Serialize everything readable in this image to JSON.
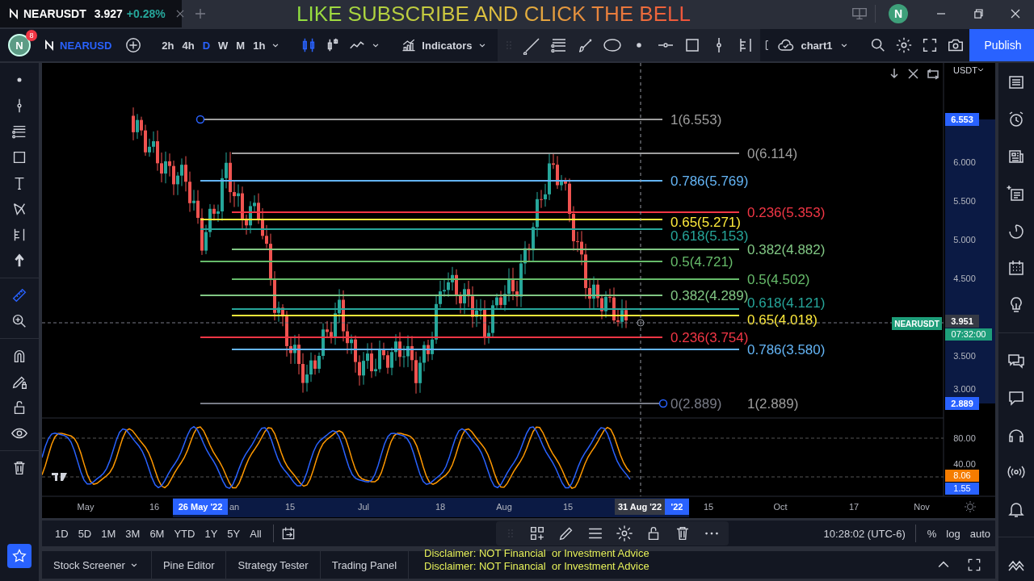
{
  "tab": {
    "symbol": "NEARUSDT",
    "price": "3.927",
    "change": "+0.28%",
    "selected": true
  },
  "banner": "LIKE SUBSCRIBE AND CLICK THE BELL",
  "account_initial": "N",
  "toolbar": {
    "avatar": "N",
    "notifications": "8",
    "symbol": "NEARUSD",
    "intervals": [
      {
        "label": "2h",
        "selected": false
      },
      {
        "label": "4h",
        "selected": false
      },
      {
        "label": "D",
        "selected": true
      },
      {
        "label": "W",
        "selected": false
      },
      {
        "label": "M",
        "selected": false
      },
      {
        "label": "1h",
        "selected": false
      }
    ],
    "chart_styles": [
      {
        "selected": true
      },
      {
        "selected": false
      },
      {
        "selected": false
      }
    ],
    "indicators": "Indicators",
    "layout": "chart1",
    "publish": "Publish"
  },
  "left_tools": [
    {
      "selected": false
    },
    {
      "selected": false
    },
    {
      "selected": false
    },
    {
      "selected": false
    },
    {
      "selected": false
    },
    {
      "selected": false
    },
    {
      "selected": false
    },
    {
      "selected": false
    },
    {
      "selected": true
    },
    {
      "selected": false
    },
    {
      "selected": false
    },
    {
      "selected": false
    },
    {
      "selected": false
    },
    {
      "selected": false
    },
    {
      "selected": false
    }
  ],
  "chart": {
    "currency": "USDT",
    "price_ticks": [
      "6.000",
      "5.500",
      "5.000",
      "4.500",
      "3.500",
      "3.000"
    ],
    "high_tag": "6.553",
    "low_tag": "2.889",
    "last": {
      "symbol": "NEARUSDT",
      "price": "3.951",
      "countdown": "07:32:00"
    },
    "fib_left": [
      {
        "label": "1(6.553)",
        "color": "#9e9e9e"
      },
      {
        "label": "0.786(5.769)",
        "color": "#64b5f6"
      },
      {
        "label": "0.65(5.271)",
        "color": "#ffeb3b"
      },
      {
        "label": "0.618(5.153)",
        "color": "#26a69a"
      },
      {
        "label": "0.5(4.721)",
        "color": "#66bb6a"
      },
      {
        "label": "0.382(4.289)",
        "color": "#81c784"
      },
      {
        "label": "0.236(3.754)",
        "color": "#f23645"
      },
      {
        "label": "0(2.889)",
        "color": "#787b86"
      }
    ],
    "fib_right": [
      {
        "label": "0(6.114)",
        "color": "#9e9e9e"
      },
      {
        "label": "0.236(5.353)",
        "color": "#f23645"
      },
      {
        "label": "0.382(4.882)",
        "color": "#81c784"
      },
      {
        "label": "0.5(4.502)",
        "color": "#66bb6a"
      },
      {
        "label": "0.618(4.121)",
        "color": "#26a69a"
      },
      {
        "label": "0.65(4.018)",
        "color": "#ffeb3b"
      },
      {
        "label": "0.786(3.580)",
        "color": "#64b5f6"
      },
      {
        "label": "1(2.889)",
        "color": "#9e9e9e"
      }
    ],
    "osc_ticks": [
      "80.00",
      "40.00"
    ],
    "osc_tags": [
      {
        "label": "8.06",
        "color": "#f57c00"
      },
      {
        "label": "1.55",
        "color": "#2962ff"
      }
    ],
    "time_ticks": [
      "May",
      "16",
      "an",
      "15",
      "Jul",
      "18",
      "Aug",
      "15",
      "15",
      "Oct",
      "17",
      "Nov"
    ],
    "range_start": "26 May '22",
    "range_end": "'22",
    "crosshair_date": "31 Aug '22"
  },
  "range_buttons": [
    "1D",
    "5D",
    "1M",
    "3M",
    "6M",
    "YTD",
    "1Y",
    "5Y",
    "All"
  ],
  "clock": "10:28:02 (UTC-6)",
  "scale_options": [
    "%",
    "log",
    "auto"
  ],
  "bottom_tabs": [
    {
      "label": "Stock Screener",
      "has_menu": true
    },
    {
      "label": "Pine Editor",
      "has_menu": false
    },
    {
      "label": "Strategy Tester",
      "has_menu": false
    },
    {
      "label": "Trading Panel",
      "has_menu": false
    }
  ],
  "disclaimers": [
    "Disclaimer: NOT Financial  or Investment Advice",
    "Disclaimer: NOT Financial  or Investment Advice"
  ]
}
